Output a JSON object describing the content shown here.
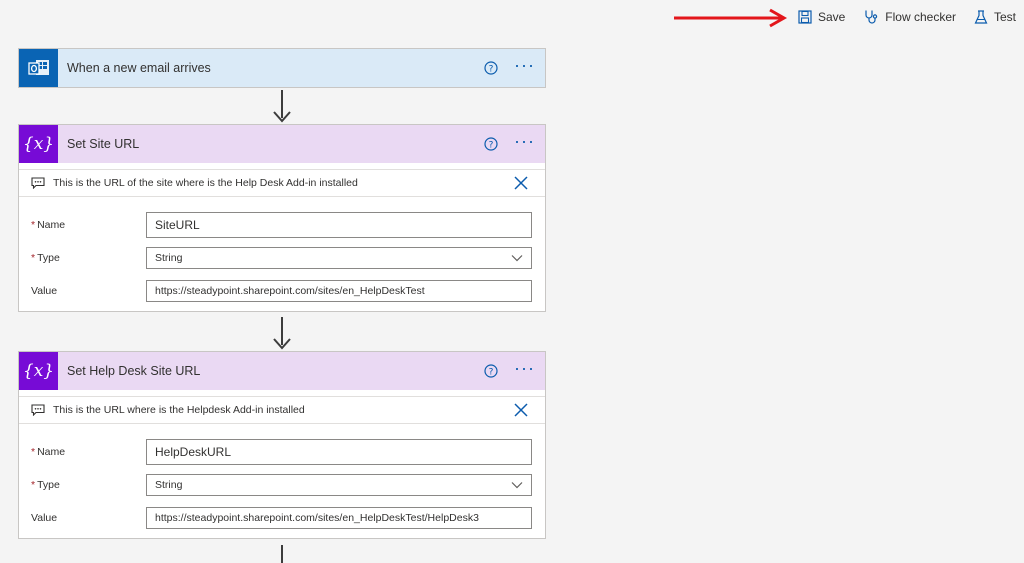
{
  "toolbar": {
    "save_label": "Save",
    "flow_checker_label": "Flow checker",
    "test_label": "Test"
  },
  "colors": {
    "accent": "#0b5cad",
    "trigger_header": "#daeaf7",
    "variable_header": "#ead9f3",
    "variable_icon": "#770bd6",
    "outlook_icon": "#0a64b4",
    "annotation_arrow": "#e3161b"
  },
  "steps": [
    {
      "title": "When a new email arrives",
      "icon": "outlook-icon"
    },
    {
      "title": "Set Site URL",
      "icon": "variable-icon",
      "icon_text": "{x}",
      "comment": "This is the URL of the site where is the Help Desk Add-in installed",
      "fields": {
        "name_label": "Name",
        "name_value": "SiteURL",
        "type_label": "Type",
        "type_value": "String",
        "value_label": "Value",
        "value_value": "https://steadypoint.sharepoint.com/sites/en_HelpDeskTest"
      }
    },
    {
      "title": "Set Help Desk Site URL",
      "icon": "variable-icon",
      "icon_text": "{x}",
      "comment": "This is the URL where is the Helpdesk Add-in installed",
      "fields": {
        "name_label": "Name",
        "name_value": "HelpDeskURL",
        "type_label": "Type",
        "type_value": "String",
        "value_label": "Value",
        "value_value": "https://steadypoint.sharepoint.com/sites/en_HelpDeskTest/HelpDesk3"
      }
    }
  ],
  "required_marker": "*"
}
